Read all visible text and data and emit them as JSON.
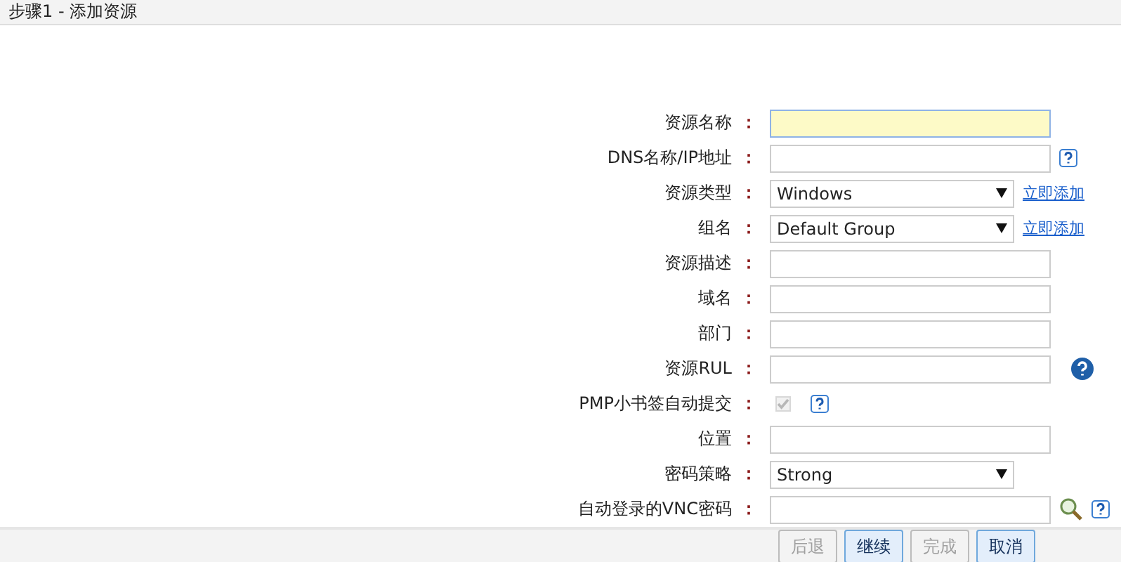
{
  "header": {
    "title": "步骤1 - 添加资源"
  },
  "fields": [
    {
      "label": "资源名称",
      "kind": "text",
      "focused": true
    },
    {
      "label": "DNS名称/IP地址",
      "kind": "text",
      "focused": false,
      "icons": [
        {
          "kind": "help_square"
        }
      ]
    },
    {
      "label": "资源类型",
      "kind": "select",
      "value": "Windows",
      "link": "立即添加"
    },
    {
      "label": "组名",
      "kind": "select",
      "value": "Default Group",
      "link": "立即添加"
    },
    {
      "label": "资源描述",
      "kind": "text",
      "focused": false
    },
    {
      "label": "域名",
      "kind": "text",
      "focused": false
    },
    {
      "label": "部门",
      "kind": "text",
      "focused": false
    },
    {
      "label": "资源RUL",
      "kind": "text",
      "focused": false,
      "icons": [
        {
          "kind": "help_round"
        }
      ]
    },
    {
      "label": "PMP小书签自动提交",
      "kind": "checkbox",
      "checked": true,
      "disabled": true,
      "icons": [
        {
          "kind": "help_square"
        }
      ]
    },
    {
      "label": "位置",
      "kind": "text",
      "focused": false
    },
    {
      "label": "密码策略",
      "kind": "select",
      "value": "Strong"
    },
    {
      "label": "自动登录的VNC密码",
      "kind": "text",
      "focused": false,
      "icons": [
        {
          "kind": "search"
        },
        {
          "kind": "help_square"
        }
      ]
    }
  ],
  "separator": "：",
  "buttons": [
    {
      "label": "后退",
      "disabled": true
    },
    {
      "label": "继续",
      "disabled": false
    },
    {
      "label": "完成",
      "disabled": true
    },
    {
      "label": "取消",
      "disabled": false
    }
  ]
}
